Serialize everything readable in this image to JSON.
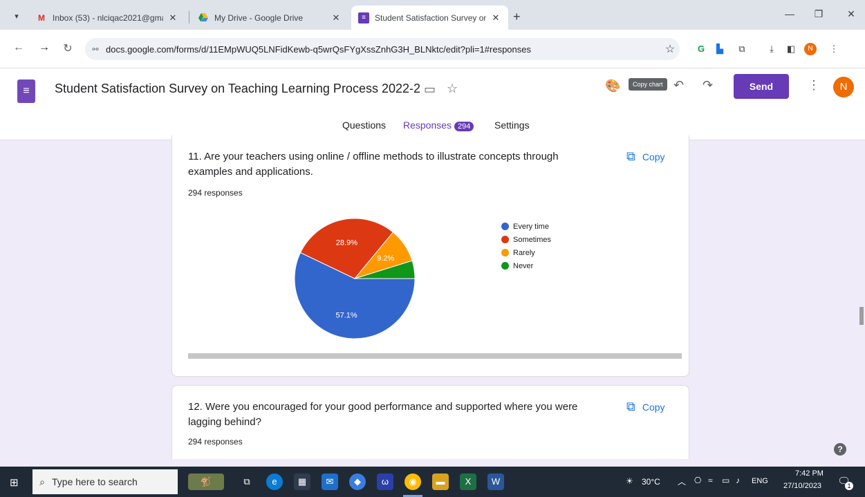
{
  "browser": {
    "tabs": [
      {
        "title": "Inbox (53) - nlciqac2021@gma",
        "favicon": "gmail-icon",
        "color": "#d93025"
      },
      {
        "title": "My Drive - Google Drive",
        "favicon": "drive-icon",
        "color": "#1a73e8"
      },
      {
        "title": "Student Satisfaction Survey on",
        "favicon": "forms-icon",
        "color": "#673ab7"
      }
    ],
    "url": "docs.google.com/forms/d/11EMpWUQ5LNFidKewb-q5wrQsFYgXssZnhG3H_BLNktc/edit?pli=1#responses",
    "profile_initial": "N"
  },
  "form": {
    "title": "Student Satisfaction Survey on Teaching Learning  Process 2022-2:",
    "tooltip": "Copy chart",
    "send_label": "Send",
    "avatar_initial": "N",
    "tabs": [
      {
        "label": "Questions"
      },
      {
        "label": "Responses",
        "count": "294"
      },
      {
        "label": "Settings"
      }
    ],
    "accent": "#673ab7"
  },
  "questions": [
    {
      "title": "11. Are your teachers using online / offline methods to illustrate concepts through examples and applications.",
      "responses": "294 responses",
      "copy_label": "Copy"
    },
    {
      "title": "12. Were you encouraged for your good performance and supported where you were lagging behind?",
      "responses": "294 responses",
      "copy_label": "Copy"
    }
  ],
  "chart_data": {
    "type": "pie",
    "slices": [
      {
        "label": "Every time",
        "value": 57.1,
        "color": "#3366cc",
        "data_label": "57.1%"
      },
      {
        "label": "Sometimes",
        "value": 28.9,
        "color": "#dc3912",
        "data_label": "28.9%"
      },
      {
        "label": "Rarely",
        "value": 9.2,
        "color": "#ff9900",
        "data_label": "9.2%"
      },
      {
        "label": "Never",
        "value": 4.8,
        "color": "#109618",
        "data_label": ""
      }
    ]
  },
  "taskbar": {
    "search_placeholder": "Type here to search",
    "temperature": "30°C",
    "language": "ENG",
    "time": "7:42 PM",
    "date": "27/10/2023",
    "notification_count": "1"
  }
}
